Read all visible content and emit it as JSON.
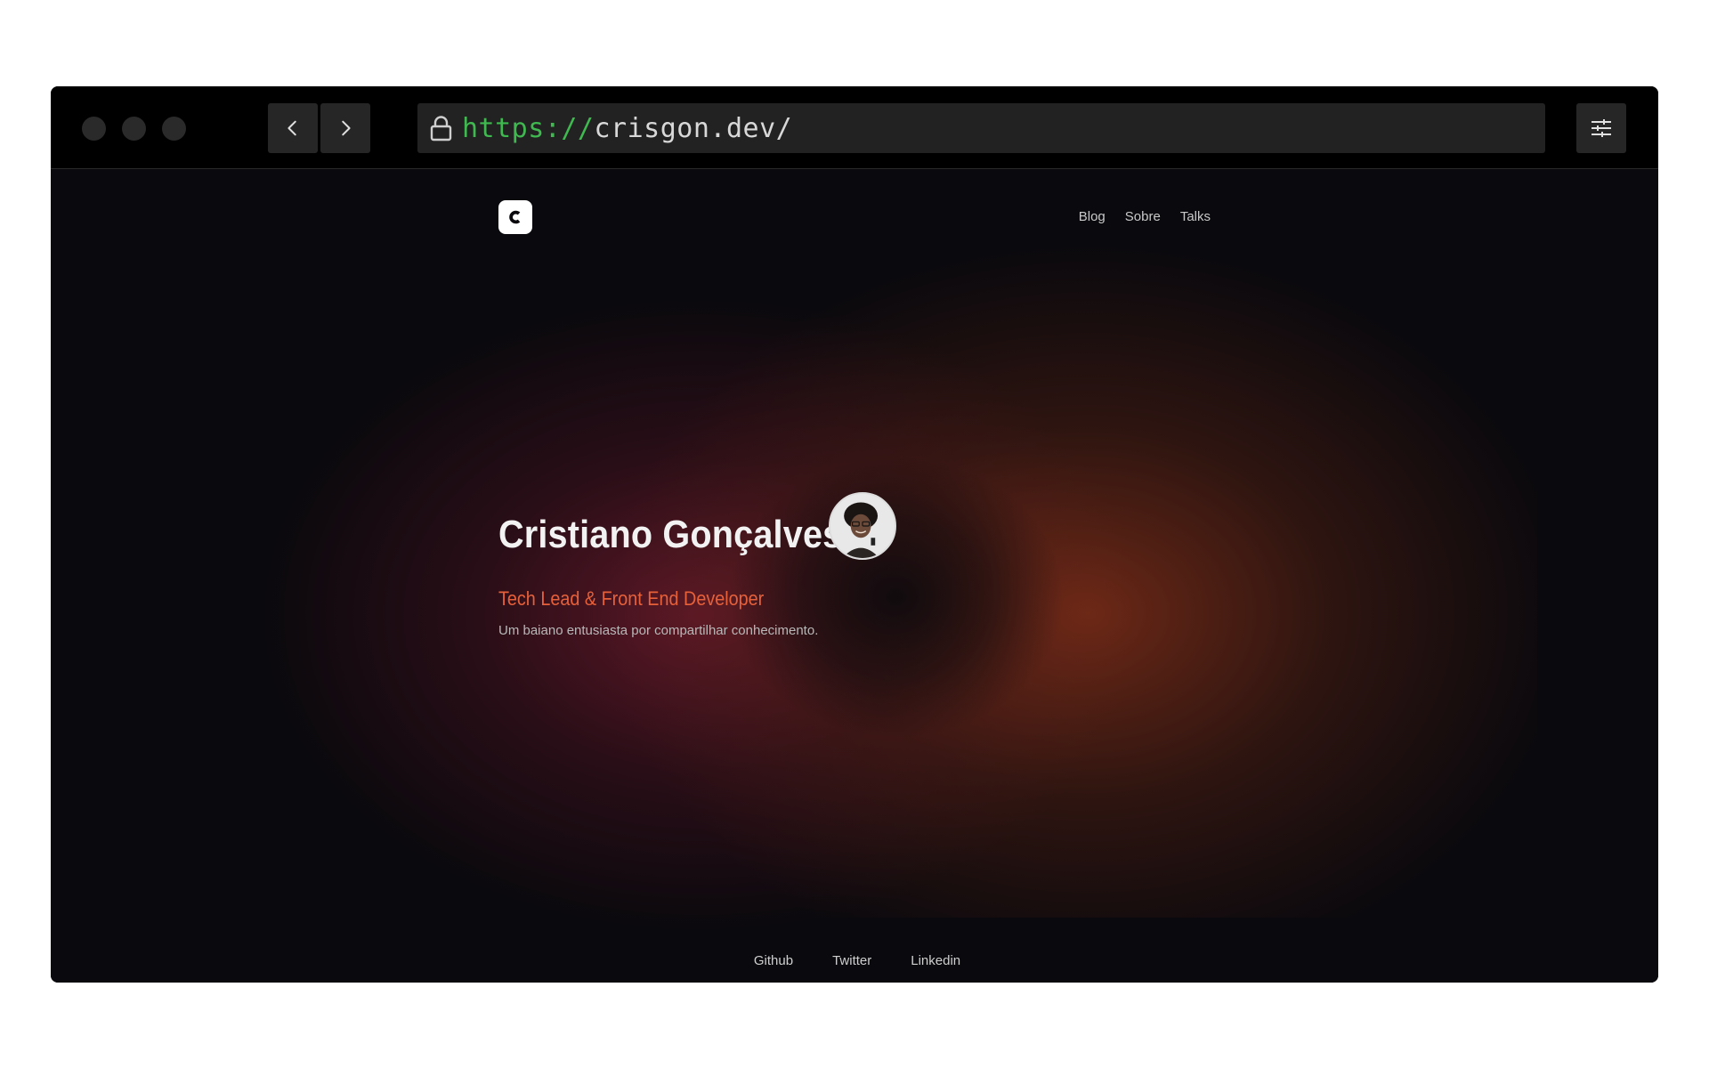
{
  "browser": {
    "url_scheme": "https://",
    "url_host": "crisgon.dev/",
    "back_icon": "chevron-left-icon",
    "forward_icon": "chevron-right-icon",
    "lock_icon": "lock-icon",
    "settings_icon": "sliders-icon"
  },
  "site": {
    "logo_letter": "c",
    "nav": [
      "Blog",
      "Sobre",
      "Talks"
    ],
    "hero": {
      "name": "Cristiano Gonçalves",
      "role": "Tech Lead & Front End Developer",
      "tagline": "Um baiano entusiasta por compartilhar conhecimento."
    },
    "footer_links": [
      "Github",
      "Twitter",
      "Linkedin"
    ]
  },
  "colors": {
    "accent": "#e6603a",
    "url_scheme": "#3fb950",
    "background": "#0a090d"
  }
}
